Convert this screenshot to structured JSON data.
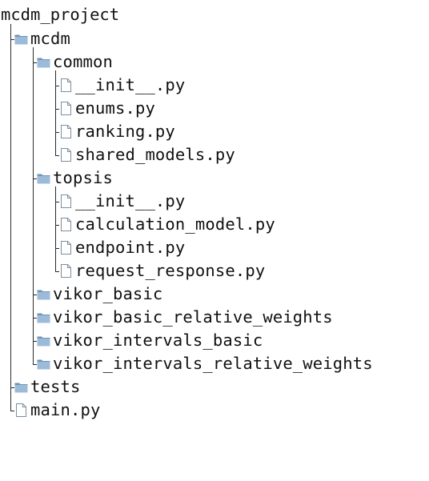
{
  "root": "mcdm_project",
  "tree": [
    {
      "label": "mcdm",
      "kind": "folder",
      "children": [
        {
          "label": "common",
          "kind": "folder",
          "children": [
            {
              "label": "__init__.py",
              "kind": "file"
            },
            {
              "label": "enums.py",
              "kind": "file"
            },
            {
              "label": "ranking.py",
              "kind": "file"
            },
            {
              "label": "shared_models.py",
              "kind": "file"
            }
          ]
        },
        {
          "label": "topsis",
          "kind": "folder",
          "children": [
            {
              "label": "__init__.py",
              "kind": "file"
            },
            {
              "label": "calculation_model.py",
              "kind": "file"
            },
            {
              "label": "endpoint.py",
              "kind": "file"
            },
            {
              "label": "request_response.py",
              "kind": "file"
            }
          ]
        },
        {
          "label": "vikor_basic",
          "kind": "folder"
        },
        {
          "label": "vikor_basic_relative_weights",
          "kind": "folder"
        },
        {
          "label": "vikor_intervals_basic",
          "kind": "folder"
        },
        {
          "label": "vikor_intervals_relative_weights",
          "kind": "folder"
        }
      ]
    },
    {
      "label": "tests",
      "kind": "folder"
    },
    {
      "label": "main.py",
      "kind": "file"
    }
  ],
  "icons": {
    "folder": "folder-icon",
    "file": "file-icon"
  },
  "colors": {
    "folder_tab": "#6f94b8",
    "folder_body": "#9cbbd9",
    "file_outline": "#7c8e9e",
    "line": "#2a2a2a"
  }
}
